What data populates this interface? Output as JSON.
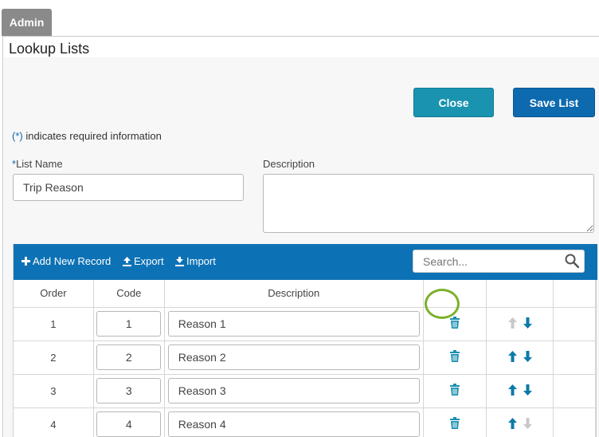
{
  "admin_tab": "Admin",
  "page_title": "Lookup Lists",
  "buttons": {
    "close": "Close",
    "save": "Save List"
  },
  "required_note": {
    "star": "(*)",
    "text": " indicates required information"
  },
  "form": {
    "list_name_label_ast": "*",
    "list_name_label": "List Name",
    "list_name_value": "Trip Reason",
    "description_label": "Description",
    "description_value": ""
  },
  "toolbar": {
    "add_new_record": "Add New Record",
    "export": "Export",
    "import": "Import",
    "search_placeholder": "Search..."
  },
  "table": {
    "headers": {
      "order": "Order",
      "code": "Code",
      "description": "Description"
    },
    "rows": [
      {
        "order": "1",
        "code": "1",
        "description": "Reason 1",
        "up_enabled": false,
        "down_enabled": true
      },
      {
        "order": "2",
        "code": "2",
        "description": "Reason 2",
        "up_enabled": true,
        "down_enabled": true
      },
      {
        "order": "3",
        "code": "3",
        "description": "Reason 3",
        "up_enabled": true,
        "down_enabled": true
      },
      {
        "order": "4",
        "code": "4",
        "description": "Reason 4",
        "up_enabled": true,
        "down_enabled": false
      }
    ]
  },
  "colors": {
    "primary": "#0d6aae",
    "toolbar": "#0d72b5",
    "close_button": "#1a93b0",
    "icon_teal": "#1a8fb0",
    "arrow_enabled": "#0d7aa8",
    "arrow_disabled": "#c8c8c8",
    "highlight_ring": "#7cb02a"
  },
  "icons": {
    "delete": "trash-icon",
    "up": "arrow-up-icon",
    "down": "arrow-down-icon",
    "search": "search-icon",
    "add": "plus-icon",
    "export": "upload-icon",
    "import": "download-icon"
  }
}
